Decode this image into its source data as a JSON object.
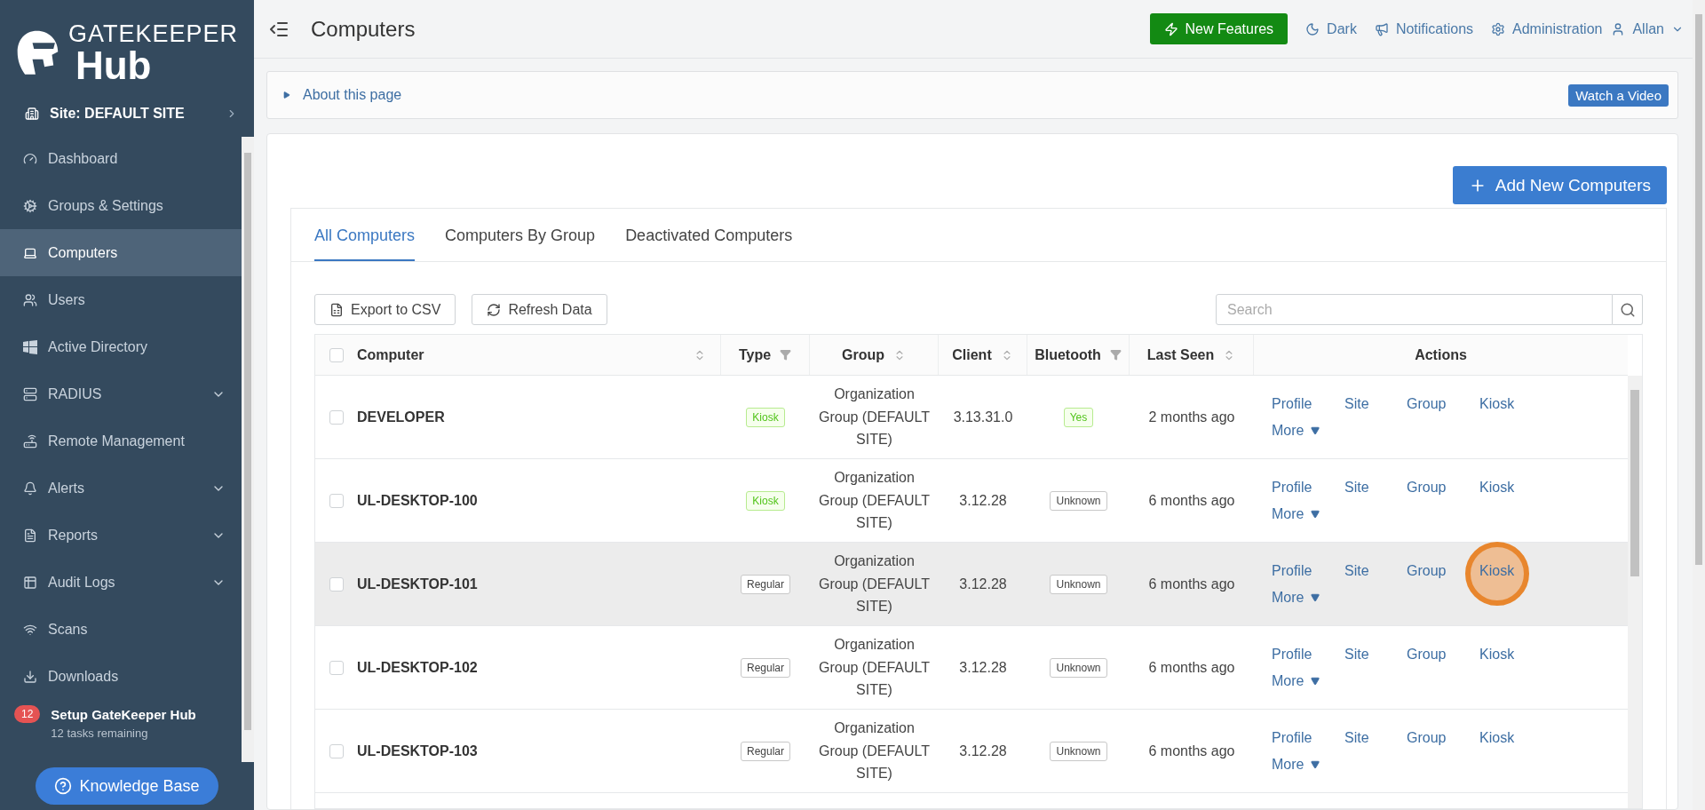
{
  "logo": {
    "line1": "GATEKEEPER",
    "line2": "Hub"
  },
  "site": {
    "label": "Site: DEFAULT SITE"
  },
  "sidebar": {
    "items": [
      {
        "label": "Dashboard",
        "selected": false,
        "expandable": false
      },
      {
        "label": "Groups & Settings",
        "selected": false,
        "expandable": false
      },
      {
        "label": "Computers",
        "selected": true,
        "expandable": false
      },
      {
        "label": "Users",
        "selected": false,
        "expandable": false
      },
      {
        "label": "Active Directory",
        "selected": false,
        "expandable": false
      },
      {
        "label": "RADIUS",
        "selected": false,
        "expandable": true
      },
      {
        "label": "Remote Management",
        "selected": false,
        "expandable": false
      },
      {
        "label": "Alerts",
        "selected": false,
        "expandable": true
      },
      {
        "label": "Reports",
        "selected": false,
        "expandable": true
      },
      {
        "label": "Audit Logs",
        "selected": false,
        "expandable": true
      },
      {
        "label": "Scans",
        "selected": false,
        "expandable": false
      },
      {
        "label": "Downloads",
        "selected": false,
        "expandable": false
      }
    ],
    "setup": {
      "count": "12",
      "title": "Setup GateKeeper Hub",
      "subtitle": "12 tasks remaining"
    },
    "knowledge_base": "Knowledge Base"
  },
  "header": {
    "title": "Computers",
    "new_features": "New Features",
    "dark": "Dark",
    "notifications": "Notifications",
    "administration": "Administration",
    "user": "Allan"
  },
  "about": {
    "label": "About this page",
    "video": "Watch a Video"
  },
  "add_button": "Add New Computers",
  "tabs": [
    {
      "label": "All Computers",
      "selected": true
    },
    {
      "label": "Computers By Group",
      "selected": false
    },
    {
      "label": "Deactivated Computers",
      "selected": false
    }
  ],
  "toolbar": {
    "export": "Export to CSV",
    "refresh": "Refresh Data",
    "search_placeholder": "Search"
  },
  "table": {
    "select_all_checked": false,
    "columns": [
      {
        "label": "Computer"
      },
      {
        "label": "Type"
      },
      {
        "label": "Group"
      },
      {
        "label": "Client"
      },
      {
        "label": "Bluetooth"
      },
      {
        "label": "Last Seen"
      },
      {
        "label": "Actions"
      }
    ],
    "rows": [
      {
        "name": "DEVELOPER",
        "type": {
          "label": "Kiosk",
          "kind": "success"
        },
        "group": "Organization Group (DEFAULT SITE)",
        "client": "3.13.31.0",
        "bluetooth": {
          "label": "Yes",
          "kind": "success"
        },
        "last_seen": "2 months ago",
        "hovered": false,
        "checked": false,
        "actions": [
          "Profile",
          "Site",
          "Group",
          "Kiosk"
        ],
        "more": "More"
      },
      {
        "name": "UL-DESKTOP-100",
        "type": {
          "label": "Kiosk",
          "kind": "success"
        },
        "group": "Organization Group (DEFAULT SITE)",
        "client": "3.12.28",
        "bluetooth": {
          "label": "Unknown",
          "kind": "neutral"
        },
        "last_seen": "6 months ago",
        "hovered": false,
        "checked": false,
        "actions": [
          "Profile",
          "Site",
          "Group",
          "Kiosk"
        ],
        "more": "More"
      },
      {
        "name": "UL-DESKTOP-101",
        "type": {
          "label": "Regular",
          "kind": "neutral"
        },
        "group": "Organization Group (DEFAULT SITE)",
        "client": "3.12.28",
        "bluetooth": {
          "label": "Unknown",
          "kind": "neutral"
        },
        "last_seen": "6 months ago",
        "hovered": true,
        "checked": false,
        "actions": [
          "Profile",
          "Site",
          "Group",
          "Kiosk"
        ],
        "more": "More",
        "click_highlight": true
      },
      {
        "name": "UL-DESKTOP-102",
        "type": {
          "label": "Regular",
          "kind": "neutral"
        },
        "group": "Organization Group (DEFAULT SITE)",
        "client": "3.12.28",
        "bluetooth": {
          "label": "Unknown",
          "kind": "neutral"
        },
        "last_seen": "6 months ago",
        "hovered": false,
        "checked": false,
        "actions": [
          "Profile",
          "Site",
          "Group",
          "Kiosk"
        ],
        "more": "More"
      },
      {
        "name": "UL-DESKTOP-103",
        "type": {
          "label": "Regular",
          "kind": "neutral"
        },
        "group": "Organization Group (DEFAULT SITE)",
        "client": "3.12.28",
        "bluetooth": {
          "label": "Unknown",
          "kind": "neutral"
        },
        "last_seen": "6 months ago",
        "hovered": false,
        "checked": false,
        "actions": [
          "Profile",
          "Site",
          "Group",
          "Kiosk"
        ],
        "more": "More"
      }
    ]
  }
}
